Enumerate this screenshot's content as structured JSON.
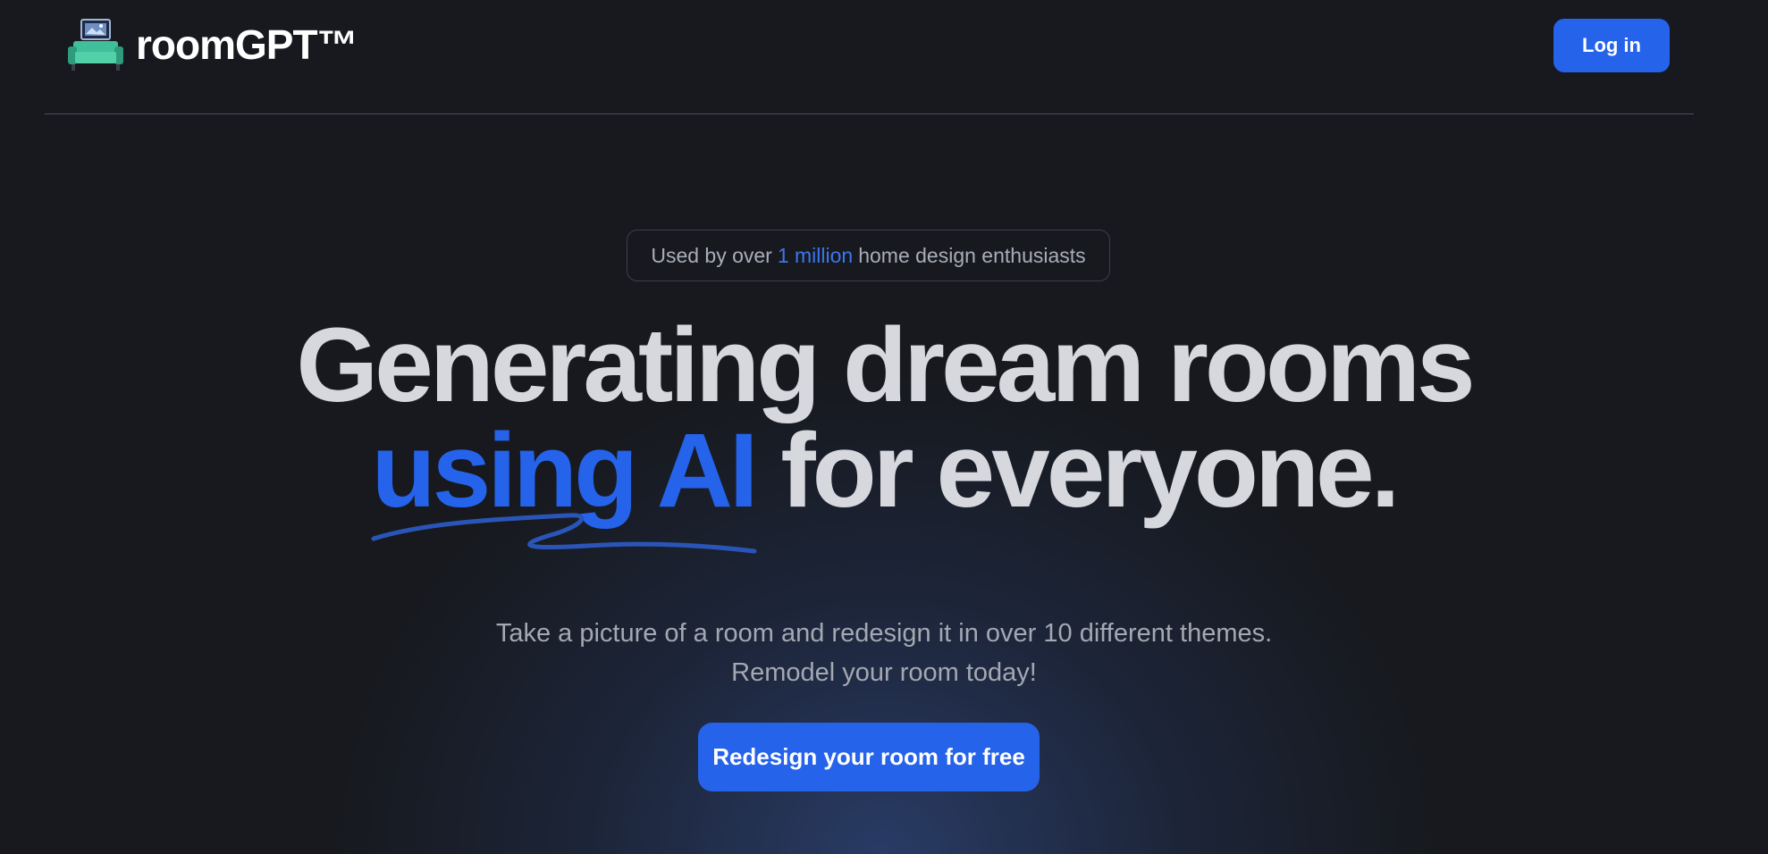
{
  "header": {
    "brand_name": "roomGPT™",
    "logo_icon": "sofa-tv-icon",
    "login_label": "Log in"
  },
  "hero": {
    "badge_prefix": "Used by over",
    "badge_highlight": "1 million",
    "badge_suffix": "home design enthusiasts",
    "headline_line1": "Generating dream rooms",
    "headline_accent": "using AI",
    "headline_rest": "for everyone.",
    "subtitle_line1": "Take a picture of a room and redesign it in over 10 different themes.",
    "subtitle_line2": "Remodel your room today!",
    "cta_label": "Redesign your room for free"
  },
  "colors": {
    "background": "#17191e",
    "accent": "#2563eb",
    "headline": "#d6d8de",
    "muted_text": "#a3a8b2"
  }
}
